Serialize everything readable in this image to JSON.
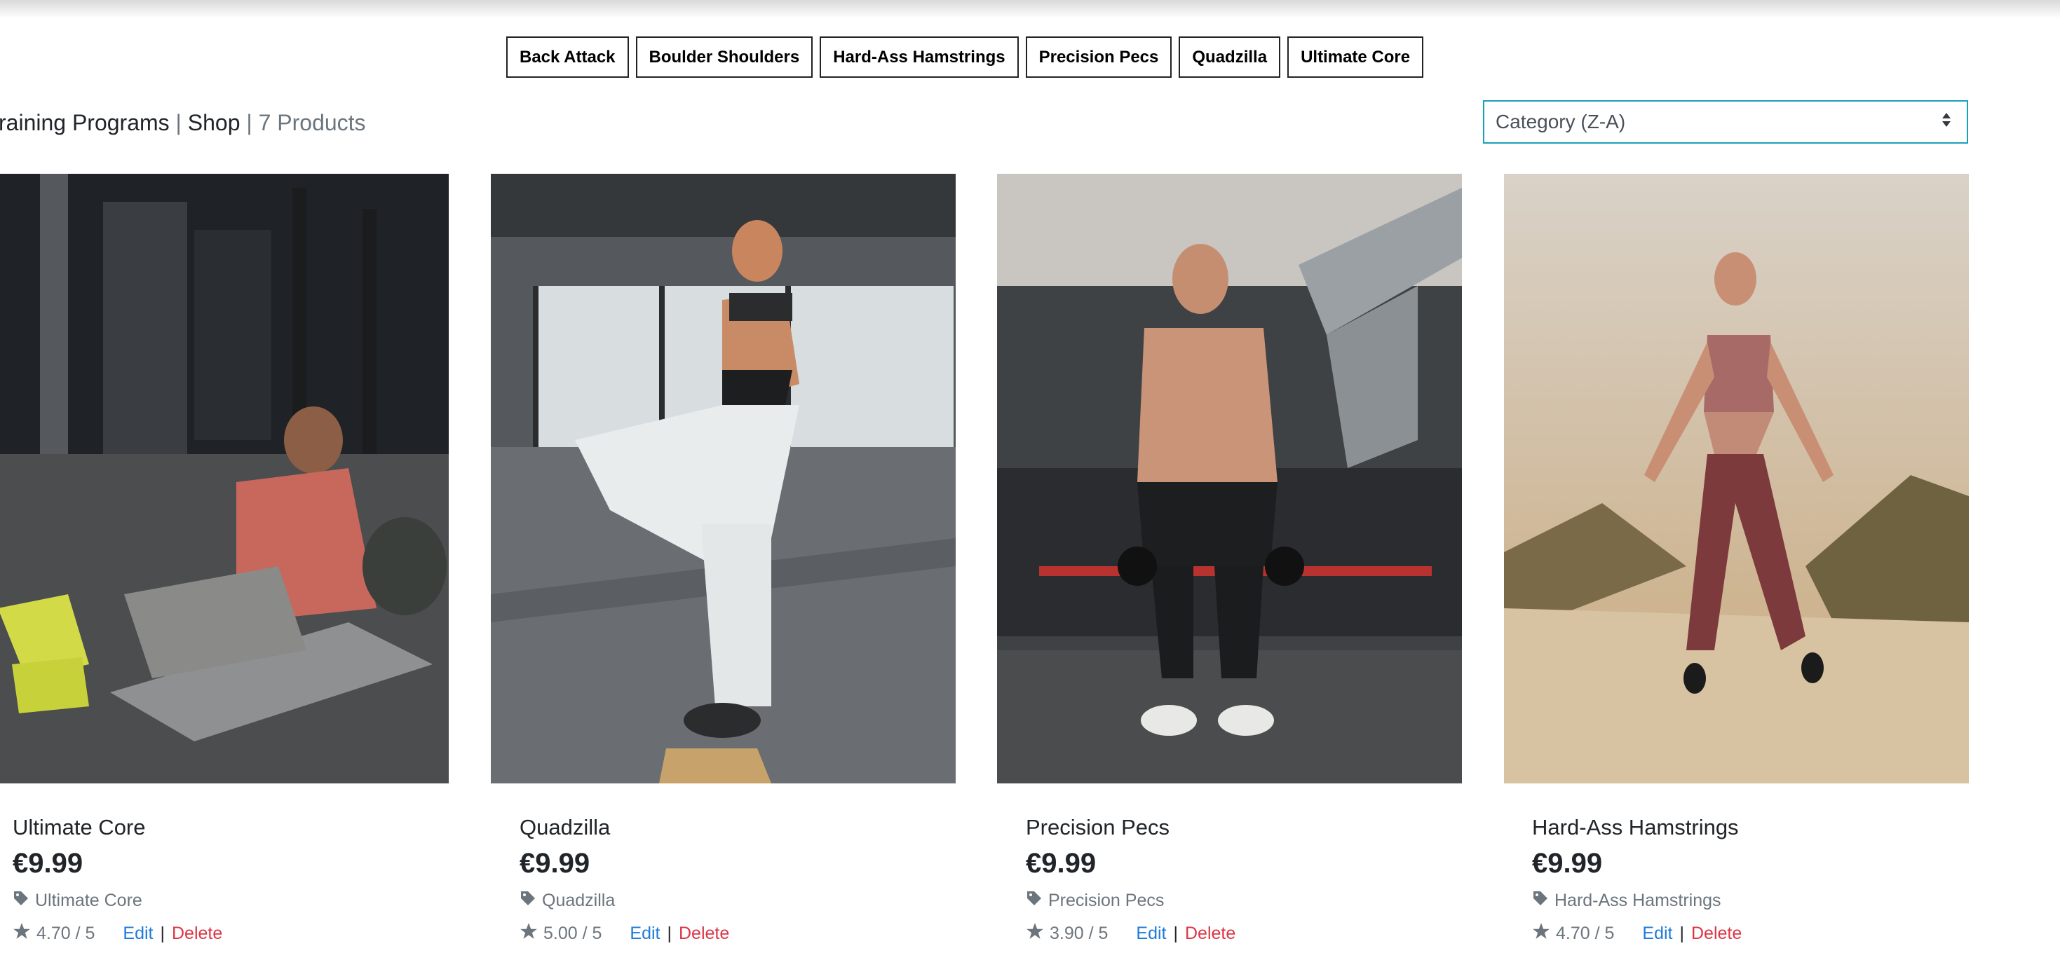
{
  "category_buttons": [
    {
      "label": "Back Attack"
    },
    {
      "label": "Boulder Shoulders"
    },
    {
      "label": "Hard-Ass Hamstrings"
    },
    {
      "label": "Precision Pecs"
    },
    {
      "label": "Quadzilla"
    },
    {
      "label": "Ultimate Core"
    }
  ],
  "breadcrumb": {
    "section": "raining Programs",
    "separator": "|",
    "page": "Shop",
    "count": "7 Products"
  },
  "sort": {
    "selected": "Category (Z-A)"
  },
  "products": [
    {
      "name": "Ultimate Core",
      "price": "€9.99",
      "category": "Ultimate Core",
      "rating": "4.70 / 5",
      "edit": "Edit",
      "sep": "|",
      "delete": "Delete"
    },
    {
      "name": "Quadzilla",
      "price": "€9.99",
      "category": "Quadzilla",
      "rating": "5.00 / 5",
      "edit": "Edit",
      "sep": "|",
      "delete": "Delete"
    },
    {
      "name": "Precision Pecs",
      "price": "€9.99",
      "category": "Precision Pecs",
      "rating": "3.90 / 5",
      "edit": "Edit",
      "sep": "|",
      "delete": "Delete"
    },
    {
      "name": "Hard-Ass Hamstrings",
      "price": "€9.99",
      "category": "Hard-Ass Hamstrings",
      "rating": "4.70 / 5",
      "edit": "Edit",
      "sep": "|",
      "delete": "Delete"
    }
  ],
  "colors": {
    "edit_link": "#1e7ad9",
    "delete_link": "#dc3545",
    "sort_border": "#17a2b8"
  }
}
